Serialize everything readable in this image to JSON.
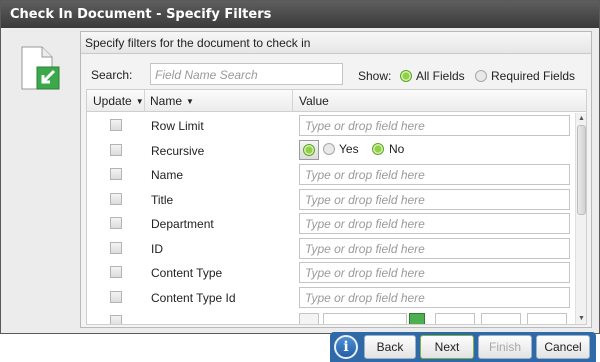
{
  "window": {
    "title": "Check In Document - Specify Filters"
  },
  "panel": {
    "heading": "Specify filters for the document to check in"
  },
  "search": {
    "label": "Search:",
    "placeholder": "Field Name Search"
  },
  "show": {
    "label": "Show:",
    "options": [
      {
        "label": "All Fields",
        "selected": true
      },
      {
        "label": "Required Fields",
        "selected": false
      }
    ]
  },
  "grid": {
    "columns": {
      "update": "Update",
      "name": "Name",
      "value": "Value"
    },
    "placeholder": "Type or drop field here",
    "rows": [
      {
        "name": "Row Limit",
        "type": "text"
      },
      {
        "name": "Recursive",
        "type": "yesno",
        "yes": "Yes",
        "no": "No",
        "selected": "No"
      },
      {
        "name": "Name",
        "type": "text"
      },
      {
        "name": "Title",
        "type": "text"
      },
      {
        "name": "Department",
        "type": "text"
      },
      {
        "name": "ID",
        "type": "text"
      },
      {
        "name": "Content Type",
        "type": "text"
      },
      {
        "name": "Content Type Id",
        "type": "text"
      }
    ]
  },
  "buttons": {
    "back": "Back",
    "next": "Next",
    "finish": "Finish",
    "cancel": "Cancel"
  },
  "icons": {
    "info": "info-icon",
    "document": "document-check-in-icon"
  },
  "colors": {
    "accent": "#2f69a8",
    "radio_on": "#8fd13f",
    "title_bar": "#4a4a4a"
  }
}
